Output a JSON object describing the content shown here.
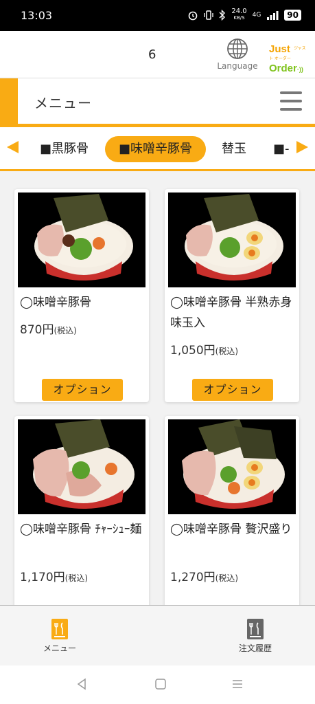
{
  "status_bar": {
    "time": "13:03",
    "speed_value": "24.0",
    "speed_unit": "KB/S",
    "network": "4G",
    "battery": "90"
  },
  "header": {
    "table_number": "6",
    "language_label": "Language",
    "logo_line1": "Just",
    "logo_line2": "Order",
    "logo_tagline": "ジャスト オーダー"
  },
  "menu_header": {
    "title": "メニュー"
  },
  "categories": [
    {
      "label": "■黒豚骨"
    },
    {
      "label": "■味噌辛豚骨"
    },
    {
      "label": "替玉"
    },
    {
      "label": "■-"
    }
  ],
  "products": [
    {
      "name": "◯味噌辛豚骨",
      "price": "870円",
      "tax": "(税込)",
      "option_label": "オプション"
    },
    {
      "name": "◯味噌辛豚骨 半熟赤身味玉入",
      "price": "1,050円",
      "tax": "(税込)",
      "option_label": "オプション"
    },
    {
      "name": "◯味噌辛豚骨 ﾁｬｰｼｭｰ麺",
      "price": "1,170円",
      "tax": "(税込)"
    },
    {
      "name": "◯味噌辛豚骨 贅沢盛り",
      "price": "1,270円",
      "tax": "(税込)"
    }
  ],
  "bottom_nav": {
    "menu_label": "メニュー",
    "history_label": "注文履歴"
  },
  "colors": {
    "accent": "#f9ab14",
    "logo_green": "#7fc31c"
  }
}
